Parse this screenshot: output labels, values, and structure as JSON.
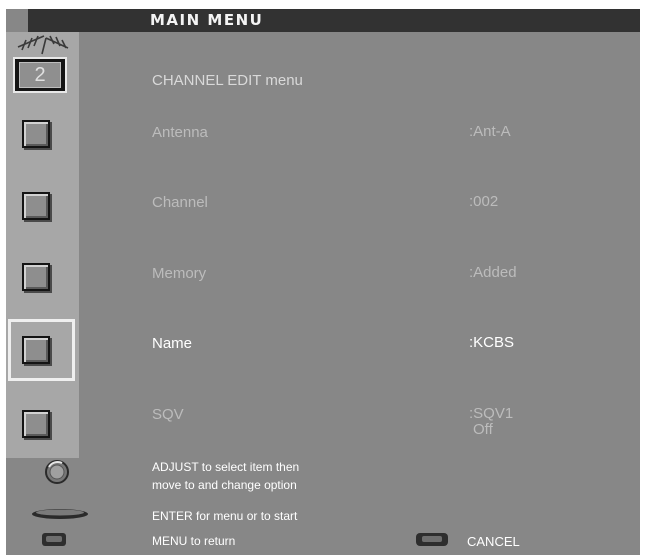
{
  "title": "MAIN MENU",
  "menu_heading": "CHANNEL EDIT menu",
  "channel_number": "2",
  "rows": [
    {
      "label": "Antenna",
      "value": ":Ant-A"
    },
    {
      "label": "Channel",
      "value": ":002"
    },
    {
      "label": "Memory",
      "value": ":Added"
    },
    {
      "label": "Name",
      "value": ":KCBS"
    },
    {
      "label": "SQV",
      "value": ":SQV1",
      "value_line2": "Off"
    }
  ],
  "selected_row": "Name",
  "footer": {
    "adjust_line1": "ADJUST to select item then",
    "adjust_line2": "move to and change option",
    "enter": "ENTER for menu or to start",
    "menu": "MENU to return",
    "cancel": "CANCEL"
  },
  "icons": {
    "antenna": "antenna-icon",
    "channel": "channel-number-icon",
    "row": "menu-item-icon",
    "knob": "adjust-knob-icon",
    "enter": "enter-button-icon",
    "menu": "menu-button-icon",
    "cancel": "cancel-button-icon"
  },
  "colors": {
    "background": "#878787",
    "sidebar": "#a7a7a7",
    "title_bar": "#323232",
    "dim_text": "#bcbcbc",
    "highlight_text": "#ffffff"
  }
}
